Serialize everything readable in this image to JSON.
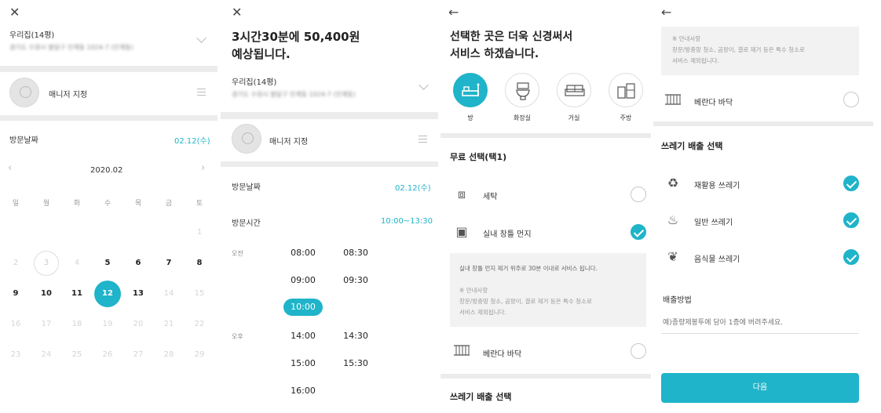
{
  "screen1": {
    "close_icon": "✕",
    "address_title": "우리집(14평)",
    "address_detail": "경기도 수원시 팔달구 인계동 1024-7 (인계동)",
    "manager_label": "매니저 지정",
    "visit_date_label": "방문날짜",
    "visit_date_value": "02.12(수)",
    "calendar": {
      "month": "2020.02",
      "weekdays": [
        "일",
        "월",
        "화",
        "수",
        "목",
        "금",
        "토"
      ],
      "weeks": [
        [
          "",
          "",
          "",
          "",
          "",
          "",
          "1"
        ],
        [
          "2",
          "3",
          "4",
          "5",
          "6",
          "7",
          "8"
        ],
        [
          "9",
          "10",
          "11",
          "12",
          "13",
          "14",
          "15"
        ],
        [
          "16",
          "17",
          "18",
          "19",
          "20",
          "21",
          "22"
        ],
        [
          "23",
          "24",
          "25",
          "26",
          "27",
          "28",
          "29"
        ]
      ],
      "selected": "12",
      "today": "3"
    }
  },
  "screen2": {
    "close_icon": "✕",
    "headline_line1": "3시간30분에 50,400원",
    "headline_line2": "예상됩니다.",
    "address_title": "우리집(14평)",
    "address_detail": "경기도 수원시 팔달구 인계동 1024-7 (인계동)",
    "manager_label": "매니저 지정",
    "visit_date_label": "방문날짜",
    "visit_date_value": "02.12(수)",
    "visit_time_label": "방문시간",
    "visit_time_value": "10:00~13:30",
    "am_label": "오전",
    "pm_label": "오후",
    "times": [
      "08:00",
      "08:30",
      "09:00",
      "09:30",
      "10:00",
      "14:00",
      "14:30",
      "15:00",
      "15:30",
      "16:00"
    ],
    "selected_time": "10:00"
  },
  "screen3": {
    "back_icon": "←",
    "headline_line1": "선택한 곳은 더욱 신경써서",
    "headline_line2": "서비스 하겠습니다.",
    "rooms": [
      {
        "label": "방",
        "icon": "bed-icon",
        "selected": true
      },
      {
        "label": "화장실",
        "icon": "toilet-icon",
        "selected": false
      },
      {
        "label": "거실",
        "icon": "sofa-icon",
        "selected": false
      },
      {
        "label": "주방",
        "icon": "kitchen-icon",
        "selected": false
      }
    ],
    "free_title": "무료 선택(택1)",
    "option_laundry": "세탁",
    "option_window": "실내 창틀 먼지",
    "notice_main": "실내 창틀 먼지 제거 위주로 30분 이내로 서비스 됩니다.",
    "notice_title": "※ 안내사항",
    "notice_body_1": "창문/방충망 청소, 곰팡이, 결로 제거 등은 특수 청소로",
    "notice_body_2": "서비스 제외됩니다.",
    "option_veranda": "베란다 바닥",
    "trash_title": "쓰레기 배출 선택"
  },
  "screen4": {
    "back_icon": "←",
    "notice_title": "※ 안내사항",
    "notice_body_1": "창문/방충망 청소, 곰팡이, 결로 제거 등은 특수 청소로",
    "notice_body_2": "서비스 제외됩니다.",
    "option_veranda": "베란다 바닥",
    "trash_title": "쓰레기 배출 선택",
    "trash_recycle": "재활용 쓰레기",
    "trash_general": "일반 쓰레기",
    "trash_food": "음식물 쓰레기",
    "method_label": "배출방법",
    "method_placeholder": "예)종량제봉투에 담아 1층에 버려주세요.",
    "next_label": "다음"
  },
  "colors": {
    "accent": "#1fb4c9",
    "divider": "#ececec"
  }
}
